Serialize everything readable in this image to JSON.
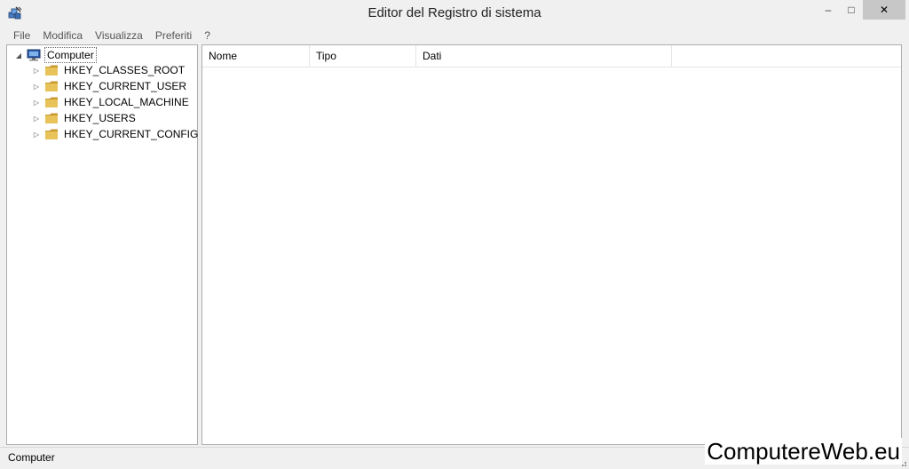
{
  "window": {
    "title": "Editor del Registro di sistema",
    "min_glyph": "–",
    "max_glyph": "□",
    "close_glyph": "✕"
  },
  "menu": {
    "items": [
      "File",
      "Modifica",
      "Visualizza",
      "Preferiti",
      "?"
    ]
  },
  "tree": {
    "root": {
      "label": "Computer",
      "expander": "◢",
      "icon": "computer-icon"
    },
    "children": [
      {
        "label": "HKEY_CLASSES_ROOT",
        "expander": "▷",
        "icon": "folder-icon"
      },
      {
        "label": "HKEY_CURRENT_USER",
        "expander": "▷",
        "icon": "folder-icon"
      },
      {
        "label": "HKEY_LOCAL_MACHINE",
        "expander": "▷",
        "icon": "folder-icon"
      },
      {
        "label": "HKEY_USERS",
        "expander": "▷",
        "icon": "folder-icon"
      },
      {
        "label": "HKEY_CURRENT_CONFIG",
        "expander": "▷",
        "icon": "folder-icon"
      }
    ]
  },
  "list": {
    "columns": [
      "Nome",
      "Tipo",
      "Dati"
    ]
  },
  "status": {
    "text": "Computer"
  },
  "watermark": "ComputereWeb.eu",
  "colors": {
    "folder": "#e8c35a",
    "folder_dark": "#c99a2e",
    "close_button": "#c7c7c7"
  }
}
